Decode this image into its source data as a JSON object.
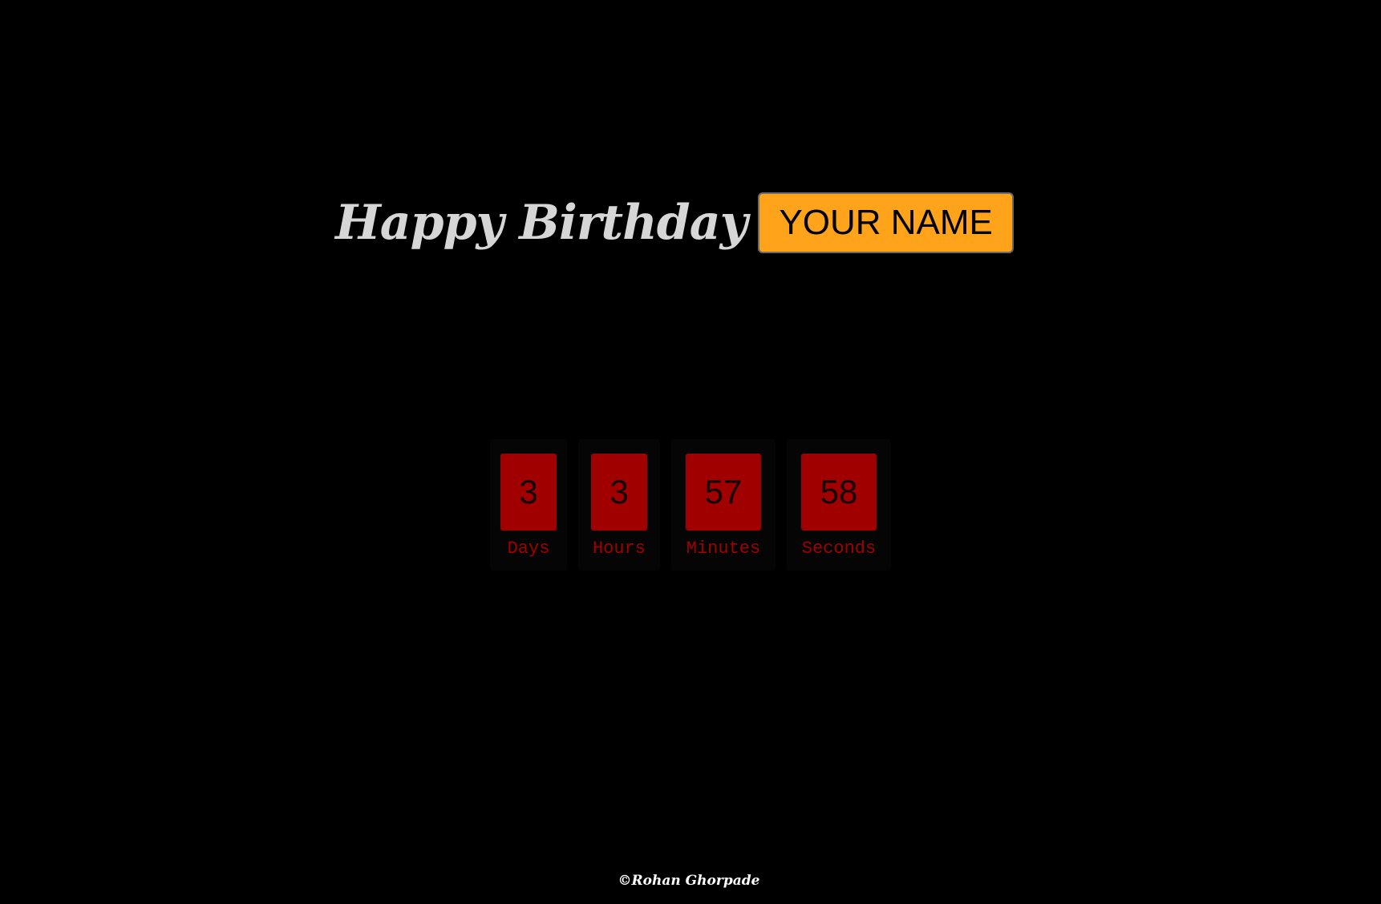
{
  "header": {
    "title": "Happy Birthday",
    "name": "YOUR NAME"
  },
  "countdown": {
    "days": {
      "value": "3",
      "label": "Days"
    },
    "hours": {
      "value": "3",
      "label": "Hours"
    },
    "minutes": {
      "value": "57",
      "label": "Minutes"
    },
    "seconds": {
      "value": "58",
      "label": "Seconds"
    }
  },
  "footer": {
    "text": "©Rohan Ghorpade"
  },
  "colors": {
    "background": "#000000",
    "accent": "#ffa31a",
    "countdown_red": "#a00000",
    "title_text": "#d6d6d6"
  }
}
